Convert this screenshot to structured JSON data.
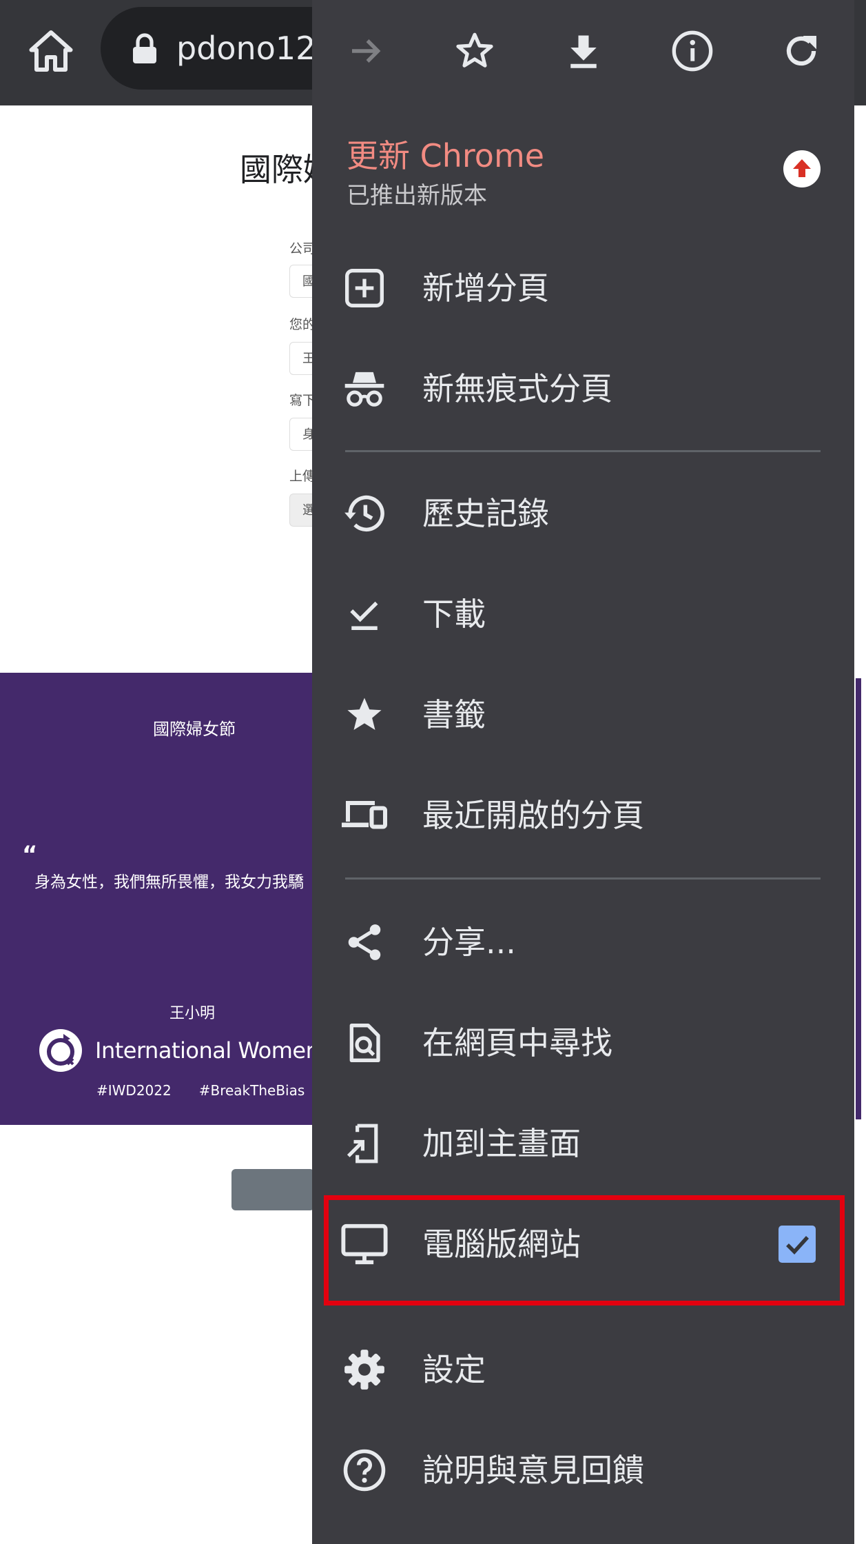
{
  "browser": {
    "url_text": "pdono12"
  },
  "page": {
    "title": "國際婦",
    "form_labels": [
      "公司",
      "您的",
      "寫下",
      "上傳"
    ],
    "form_values": [
      "國",
      "王",
      "身",
      "選"
    ],
    "banner": {
      "title": "國際婦女節",
      "quote_mark": "“",
      "quote": "身為女性，我們無所畏懼，我女力我驕",
      "author": "王小明",
      "iwd_text": "International Women's D",
      "hashtags": [
        "#IWD2022",
        "#BreakTheBias"
      ]
    }
  },
  "menu": {
    "toolbar_icons": [
      "forward-icon",
      "bookmark-star-icon",
      "download-icon",
      "info-icon",
      "reload-icon"
    ],
    "update": {
      "title": "更新 Chrome",
      "subtitle": "已推出新版本"
    },
    "items": [
      {
        "label": "新增分頁",
        "icon": "new-tab-icon"
      },
      {
        "label": "新無痕式分頁",
        "icon": "incognito-icon"
      },
      {
        "label": "歷史記錄",
        "icon": "history-icon"
      },
      {
        "label": "下載",
        "icon": "downloads-icon"
      },
      {
        "label": "書籤",
        "icon": "bookmarks-icon"
      },
      {
        "label": "最近開啟的分頁",
        "icon": "recent-tabs-icon"
      },
      {
        "label": "分享...",
        "icon": "share-icon"
      },
      {
        "label": "在網頁中尋找",
        "icon": "find-in-page-icon"
      },
      {
        "label": "加到主畫面",
        "icon": "add-to-home-icon"
      },
      {
        "label": "電腦版網站",
        "icon": "desktop-icon",
        "checked": true
      },
      {
        "label": "設定",
        "icon": "settings-icon"
      },
      {
        "label": "說明與意見回饋",
        "icon": "help-icon"
      }
    ]
  },
  "colors": {
    "menu_bg": "#3c3c41",
    "update_accent": "#f28b82",
    "banner_purple": "#44296b",
    "highlight_red": "#e3000f",
    "checkbox_blue": "#8ab4f8"
  }
}
